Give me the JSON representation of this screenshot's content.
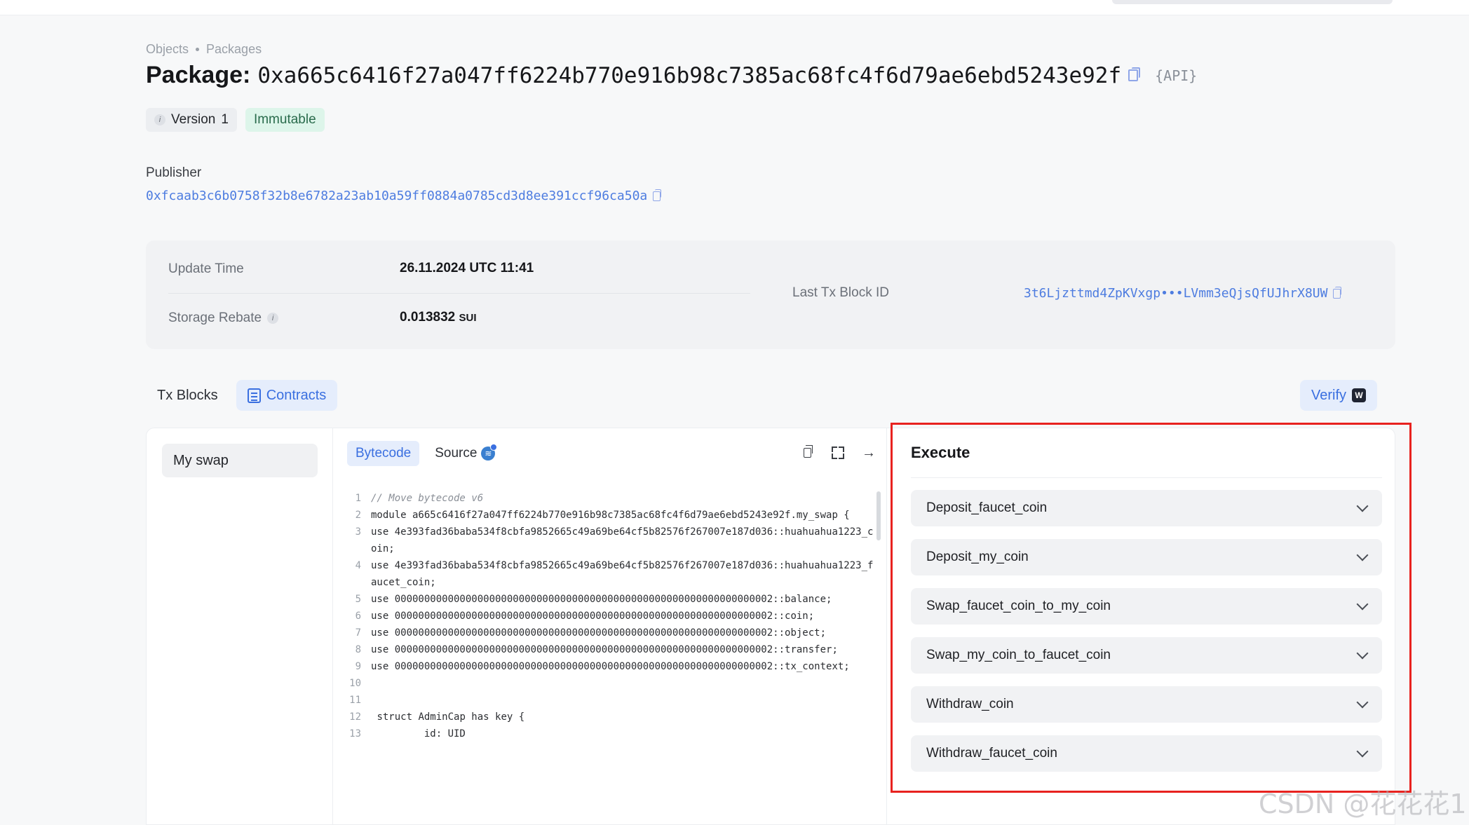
{
  "breadcrumb": {
    "item1": "Objects",
    "item2": "Packages"
  },
  "package": {
    "title_prefix": "Package:",
    "address": "0xa665c6416f27a047ff6224b770e916b98c7385ac68fc4f6d79ae6ebd5243e92f",
    "api_label": "{API}"
  },
  "badges": {
    "version_label": "Version",
    "version_value": "1",
    "immutable": "Immutable"
  },
  "publisher": {
    "label": "Publisher",
    "address": "0xfcaab3c6b0758f32b8e6782a23ab10a59ff0884a0785cd3d8ee391ccf96ca50a"
  },
  "info": {
    "update_time_label": "Update Time",
    "update_time_value": "26.11.2024 UTC 11:41",
    "storage_rebate_label": "Storage Rebate",
    "storage_rebate_value": "0.013832",
    "storage_rebate_unit": "SUI",
    "last_tx_label": "Last Tx Block ID",
    "last_tx_value": "3t6Ljzttmd4ZpKVxgp•••LVmm3eQjsQfUJhrX8UW"
  },
  "tabs": {
    "tx_blocks": "Tx Blocks",
    "contracts": "Contracts",
    "verify": "Verify"
  },
  "modules": {
    "selected": "My swap"
  },
  "code": {
    "tab_bytecode": "Bytecode",
    "tab_source": "Source",
    "lines": [
      {
        "n": "1",
        "text": "// Move bytecode v6"
      },
      {
        "n": "2",
        "text": "module a665c6416f27a047ff6224b770e916b98c7385ac68fc4f6d79ae6ebd5243e92f.my_swap {"
      },
      {
        "n": "3",
        "text": "use 4e393fad36baba534f8cbfa9852665c49a69be64cf5b82576f267007e187d036::huahuahua1223_coin;"
      },
      {
        "n": "4",
        "text": "use 4e393fad36baba534f8cbfa9852665c49a69be64cf5b82576f267007e187d036::huahuahua1223_faucet_coin;"
      },
      {
        "n": "5",
        "text": "use 0000000000000000000000000000000000000000000000000000000000000002::balance;"
      },
      {
        "n": "6",
        "text": "use 0000000000000000000000000000000000000000000000000000000000000002::coin;"
      },
      {
        "n": "7",
        "text": "use 0000000000000000000000000000000000000000000000000000000000000002::object;"
      },
      {
        "n": "8",
        "text": "use 0000000000000000000000000000000000000000000000000000000000000002::transfer;"
      },
      {
        "n": "9",
        "text": "use 0000000000000000000000000000000000000000000000000000000000000002::tx_context;"
      },
      {
        "n": "10",
        "text": ""
      },
      {
        "n": "11",
        "text": ""
      },
      {
        "n": "12",
        "text": " struct AdminCap has key {"
      },
      {
        "n": "13",
        "text": "         id: UID"
      }
    ]
  },
  "execute": {
    "title": "Execute",
    "functions": [
      "Deposit_faucet_coin",
      "Deposit_my_coin",
      "Swap_faucet_coin_to_my_coin",
      "Swap_my_coin_to_faucet_coin",
      "Withdraw_coin",
      "Withdraw_faucet_coin"
    ]
  },
  "watermark": "CSDN @花花花1",
  "colors": {
    "accent": "#3a6fe0",
    "highlight": "#e8221f",
    "immutable_bg": "#ddf5ea"
  }
}
